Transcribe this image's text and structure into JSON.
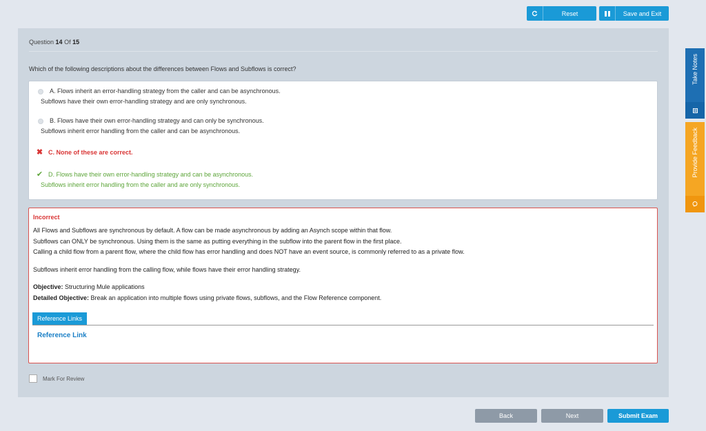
{
  "toolbar": {
    "reset_label": "Reset",
    "save_exit_label": "Save and Exit"
  },
  "question": {
    "prefix": "Question",
    "number": "14",
    "of_label": "Of",
    "total": "15",
    "text": "Which of the following descriptions about the differences between Flows and Subflows is correct?"
  },
  "options": [
    {
      "line1": "A. Flows inherit an error-handling strategy from the caller and can be asynchronous.",
      "line2": "Subflows have their own error-handling strategy and are only synchronous.",
      "state": "unselected"
    },
    {
      "line1": "B. Flows have their own error-handling strategy and can only be synchronous.",
      "line2": "Subflows inherit error handling from the caller and can be asynchronous.",
      "state": "unselected"
    },
    {
      "line1": "C. None of these are correct.",
      "line2": "",
      "state": "wrong"
    },
    {
      "line1": "D. Flows have their own error-handling strategy and can be asynchronous.",
      "line2": "Subflows inherit error handling from the caller and are only synchronous.",
      "state": "correct"
    }
  ],
  "explanation": {
    "title": "Incorrect",
    "lines": [
      "All Flows and Subflows are synchronous by default. A flow can be made asynchronous by adding an Asynch scope within that flow.",
      "Subflows can ONLY be synchronous. Using them is the same as putting everything in the subflow into the parent flow in the first place.",
      "Calling a child flow from a parent flow, where the child flow has error handling and does NOT have an event source, is commonly referred to as a private flow.",
      "Subflows inherit error handling from the calling flow, while flows have their error handling strategy."
    ],
    "objective_label": "Objective:",
    "objective": "Structuring Mule applications",
    "detailed_label": "Detailed Objective:",
    "detailed": "Break an application into multiple flows using private flows, subflows, and the Flow Reference component.",
    "ref_tab": "Reference Links",
    "ref_link": "Reference Link"
  },
  "review": {
    "label": "Mark For Review"
  },
  "nav": {
    "back": "Back",
    "next": "Next",
    "submit": "Submit Exam"
  },
  "side": {
    "notes": "Take Notes",
    "feedback": "Provide Feedback"
  },
  "colors": {
    "accent": "#1a9ad7",
    "wrong": "#d93535",
    "correct": "#5da53a",
    "notes_tab": "#1e6fb3",
    "feedback_tab": "#f5a623"
  }
}
